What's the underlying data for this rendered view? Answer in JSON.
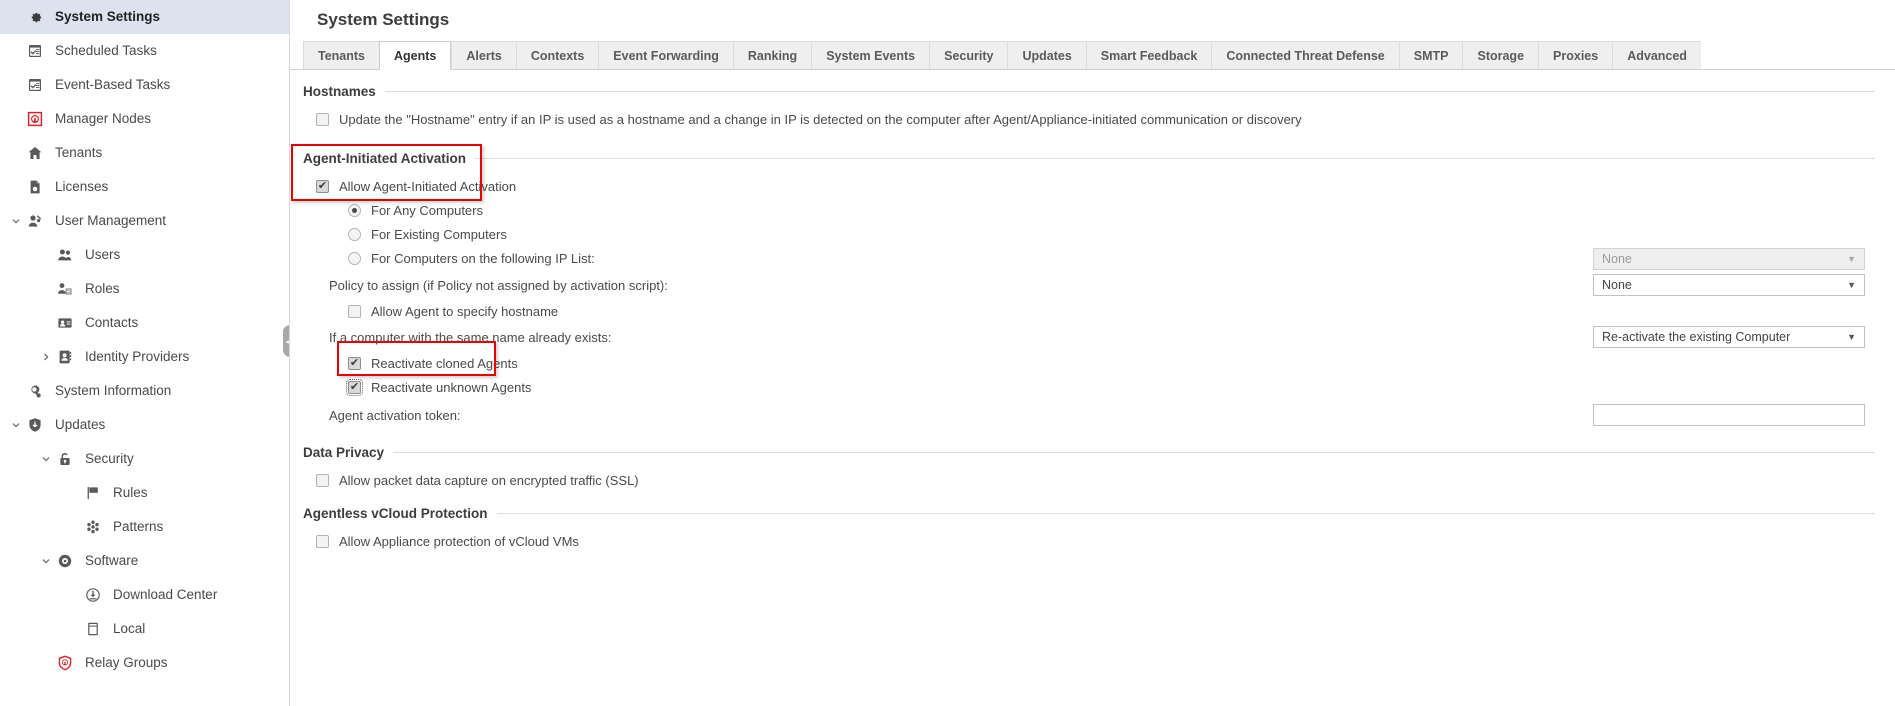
{
  "sidebar": {
    "items": [
      {
        "label": "System Settings",
        "icon": "gear-icon",
        "level": 0,
        "selected": true,
        "caret": ""
      },
      {
        "label": "Scheduled Tasks",
        "icon": "calendar-check-icon",
        "level": 0,
        "selected": false,
        "caret": ""
      },
      {
        "label": "Event-Based Tasks",
        "icon": "calendar-check-icon",
        "level": 0,
        "selected": false,
        "caret": ""
      },
      {
        "label": "Manager Nodes",
        "icon": "manager-node-icon",
        "level": 0,
        "selected": false,
        "caret": ""
      },
      {
        "label": "Tenants",
        "icon": "home-icon",
        "level": 0,
        "selected": false,
        "caret": ""
      },
      {
        "label": "Licenses",
        "icon": "document-icon",
        "level": 0,
        "selected": false,
        "caret": ""
      },
      {
        "label": "User Management",
        "icon": "user-management-icon",
        "level": 0,
        "selected": false,
        "caret": "down"
      },
      {
        "label": "Users",
        "icon": "users-icon",
        "level": 1,
        "selected": false,
        "caret": ""
      },
      {
        "label": "Roles",
        "icon": "roles-icon",
        "level": 1,
        "selected": false,
        "caret": ""
      },
      {
        "label": "Contacts",
        "icon": "contacts-icon",
        "level": 1,
        "selected": false,
        "caret": ""
      },
      {
        "label": "Identity Providers",
        "icon": "identity-provider-icon",
        "level": 1,
        "selected": false,
        "caret": "right"
      },
      {
        "label": "System Information",
        "icon": "system-info-icon",
        "level": 0,
        "selected": false,
        "caret": ""
      },
      {
        "label": "Updates",
        "icon": "updates-shield-icon",
        "level": 0,
        "selected": false,
        "caret": "down"
      },
      {
        "label": "Security",
        "icon": "lock-icon",
        "level": 1,
        "selected": false,
        "caret": "down"
      },
      {
        "label": "Rules",
        "icon": "flag-icon",
        "level": 2,
        "selected": false,
        "caret": ""
      },
      {
        "label": "Patterns",
        "icon": "patterns-icon",
        "level": 2,
        "selected": false,
        "caret": ""
      },
      {
        "label": "Software",
        "icon": "disc-icon",
        "level": 1,
        "selected": false,
        "caret": "down"
      },
      {
        "label": "Download Center",
        "icon": "download-icon",
        "level": 2,
        "selected": false,
        "caret": ""
      },
      {
        "label": "Local",
        "icon": "server-icon",
        "level": 2,
        "selected": false,
        "caret": ""
      },
      {
        "label": "Relay Groups",
        "icon": "relay-group-icon",
        "level": 1,
        "selected": false,
        "caret": ""
      }
    ],
    "collapse_handle": "◀"
  },
  "header": {
    "title": "System Settings"
  },
  "tabs": [
    {
      "label": "Tenants",
      "active": false
    },
    {
      "label": "Agents",
      "active": true
    },
    {
      "label": "Alerts",
      "active": false
    },
    {
      "label": "Contexts",
      "active": false
    },
    {
      "label": "Event Forwarding",
      "active": false
    },
    {
      "label": "Ranking",
      "active": false
    },
    {
      "label": "System Events",
      "active": false
    },
    {
      "label": "Security",
      "active": false
    },
    {
      "label": "Updates",
      "active": false
    },
    {
      "label": "Smart Feedback",
      "active": false
    },
    {
      "label": "Connected Threat Defense",
      "active": false
    },
    {
      "label": "SMTP",
      "active": false
    },
    {
      "label": "Storage",
      "active": false
    },
    {
      "label": "Proxies",
      "active": false
    },
    {
      "label": "Advanced",
      "active": false
    }
  ],
  "sections": {
    "hostnames": {
      "title": "Hostnames",
      "update_hostname_label": "Update the \"Hostname\" entry if an IP is used as a hostname and a change in IP is detected on the computer after Agent/Appliance-initiated communication or discovery",
      "update_hostname_checked": false
    },
    "agent_initiated_activation": {
      "title": "Agent-Initiated Activation",
      "allow_label": "Allow Agent-Initiated Activation",
      "allow_checked": true,
      "radios": [
        {
          "label": "For Any Computers",
          "selected": true
        },
        {
          "label": "For Existing Computers",
          "selected": false
        },
        {
          "label": "For Computers on the following IP List:",
          "selected": false
        }
      ],
      "ip_list_value": "None",
      "ip_list_disabled": true,
      "policy_label": "Policy to assign (if Policy not assigned by activation script):",
      "policy_value": "None",
      "allow_agent_hostname_label": "Allow Agent to specify hostname",
      "allow_agent_hostname_checked": false,
      "same_name_label": "If a computer with the same name already exists:",
      "same_name_value": "Re-activate the existing Computer",
      "reactivate_cloned_label": "Reactivate cloned Agents",
      "reactivate_cloned_checked": true,
      "reactivate_unknown_label": "Reactivate unknown Agents",
      "reactivate_unknown_checked": true,
      "token_label": "Agent activation token:",
      "token_value": ""
    },
    "data_privacy": {
      "title": "Data Privacy",
      "packet_capture_label": "Allow packet data capture on encrypted traffic (SSL)",
      "packet_capture_checked": false
    },
    "agentless_vcloud": {
      "title": "Agentless vCloud Protection",
      "vcloud_label": "Allow Appliance protection of vCloud VMs",
      "vcloud_checked": false
    }
  },
  "annotations": {
    "highlight_color": "#e60000",
    "boxes": [
      {
        "name": "agent-initiated-activation-highlight"
      },
      {
        "name": "reactivate-agents-highlight"
      }
    ]
  },
  "icons": {
    "dropdown_arrow": "▼",
    "caret_down": "∨",
    "caret_right": "›"
  }
}
